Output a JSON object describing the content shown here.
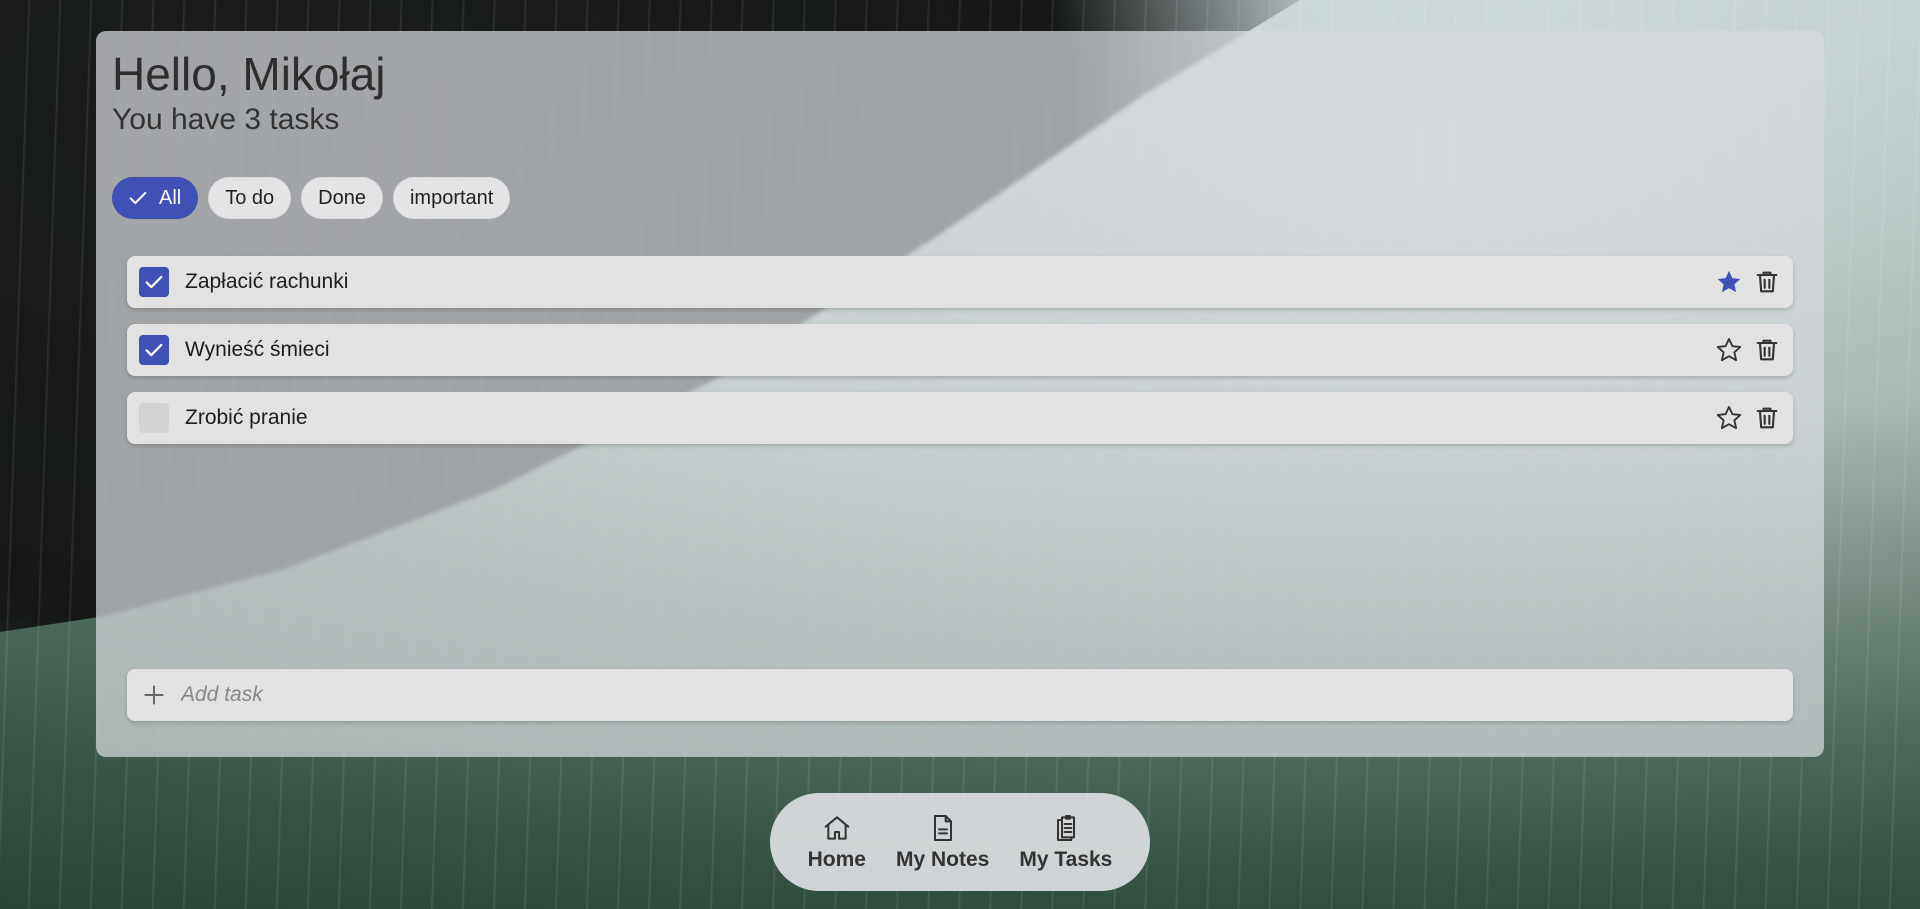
{
  "header": {
    "greeting": "Hello, Mikołaj",
    "subtitle": "You have 3 tasks"
  },
  "filters": [
    {
      "label": "All",
      "active": true
    },
    {
      "label": "To do",
      "active": false
    },
    {
      "label": "Done",
      "active": false
    },
    {
      "label": "important",
      "active": false
    }
  ],
  "tasks": [
    {
      "label": "Zapłacić rachunki",
      "done": true,
      "important": true
    },
    {
      "label": "Wynieść śmieci",
      "done": true,
      "important": false
    },
    {
      "label": "Zrobić pranie",
      "done": false,
      "important": false
    }
  ],
  "add_task": {
    "placeholder": "Add task"
  },
  "nav": [
    {
      "label": "Home",
      "icon": "home-icon"
    },
    {
      "label": "My Notes",
      "icon": "note-icon"
    },
    {
      "label": "My Tasks",
      "icon": "clipboard-icon"
    }
  ],
  "colors": {
    "accent": "#3f51b5",
    "star_filled": "#3f51b5"
  }
}
